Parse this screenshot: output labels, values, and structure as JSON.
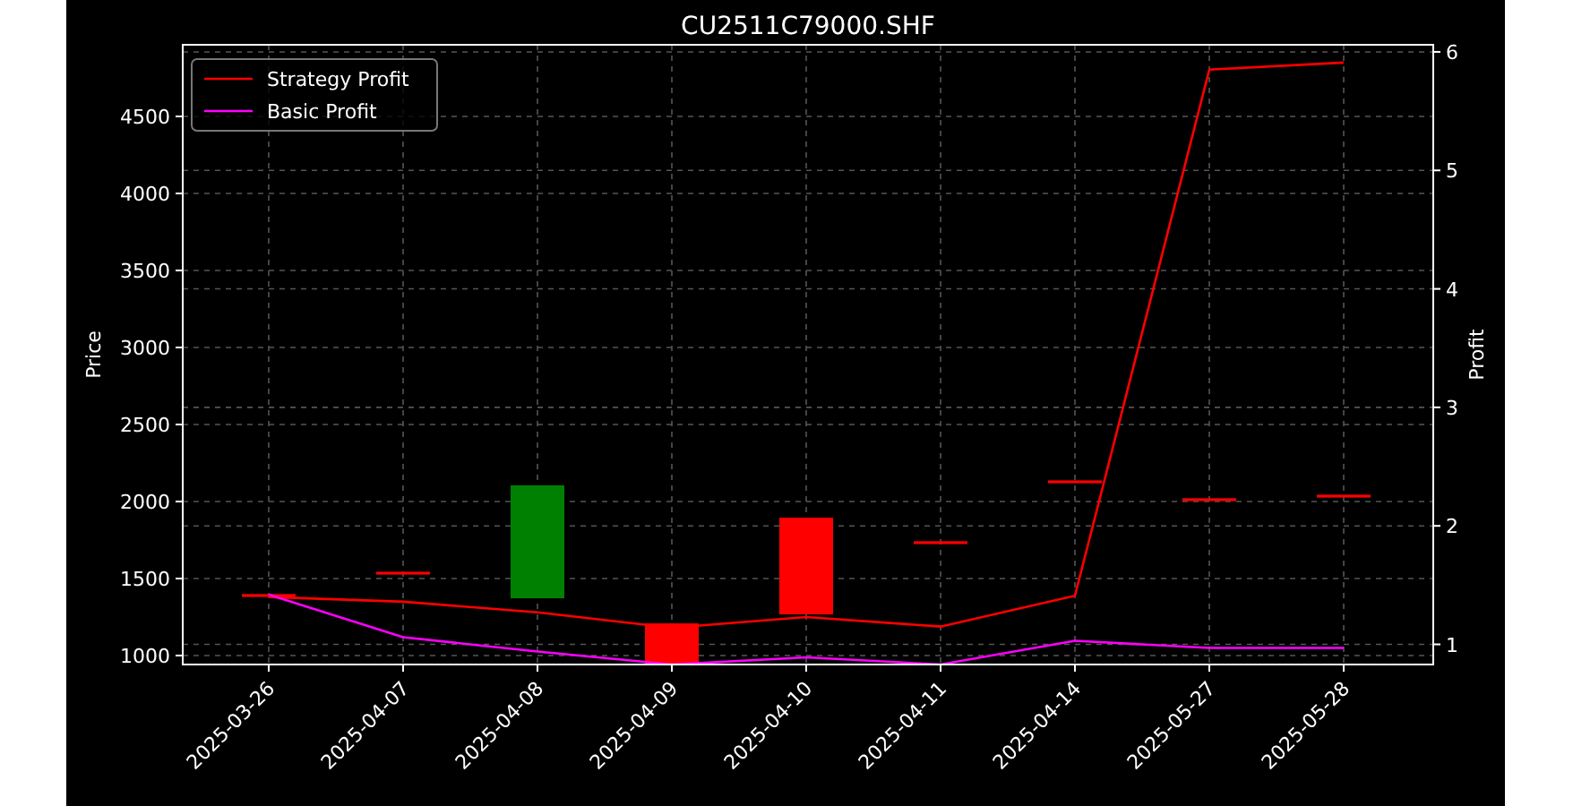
{
  "figure": {
    "chart_data": {
      "type": "line",
      "title": "CU2511C79000.SHF",
      "ylabel": "Price",
      "y2label": "Profit",
      "grid": true,
      "legend": true,
      "categories": [
        "2025-03-26",
        "2025-04-07",
        "2025-04-08",
        "2025-04-09",
        "2025-04-10",
        "2025-04-11",
        "2025-04-14",
        "2025-05-27",
        "2025-05-28"
      ],
      "ylim": [
        942,
        4965
      ],
      "yticks": [
        1000,
        1500,
        2000,
        2500,
        3000,
        3500,
        4000,
        4500
      ],
      "y2lim": [
        0.83,
        6.06
      ],
      "y2ticks": [
        1,
        2,
        3,
        4,
        5,
        6
      ],
      "series": [
        {
          "type": "candlestick",
          "ohlc": [
            [
              1395,
              1395,
              1385,
              1385
            ],
            [
              1540,
              1540,
              1530,
              1530
            ],
            [
              1372,
              2105,
              1372,
              2105
            ],
            [
              1209,
              1209,
              945,
              945
            ],
            [
              1895,
              1895,
              1267,
              1267
            ],
            [
              1738,
              1738,
              1728,
              1728
            ],
            [
              2133,
              2133,
              2123,
              2123
            ],
            [
              2017,
              2017,
              2007,
              2007
            ],
            [
              2040,
              2040,
              2030,
              2030
            ]
          ]
        },
        {
          "name": "Strategy Profit",
          "axis": "y2",
          "color": "#ff0000",
          "values": [
            1.4,
            1.36,
            1.27,
            1.14,
            1.23,
            1.15,
            1.41,
            5.85,
            5.91
          ]
        },
        {
          "name": "Basic Profit",
          "axis": "y2",
          "color": "#ff00ff",
          "values": [
            1.42,
            1.06,
            0.94,
            0.83,
            0.89,
            0.83,
            1.03,
            0.97,
            0.97
          ]
        }
      ]
    }
  }
}
